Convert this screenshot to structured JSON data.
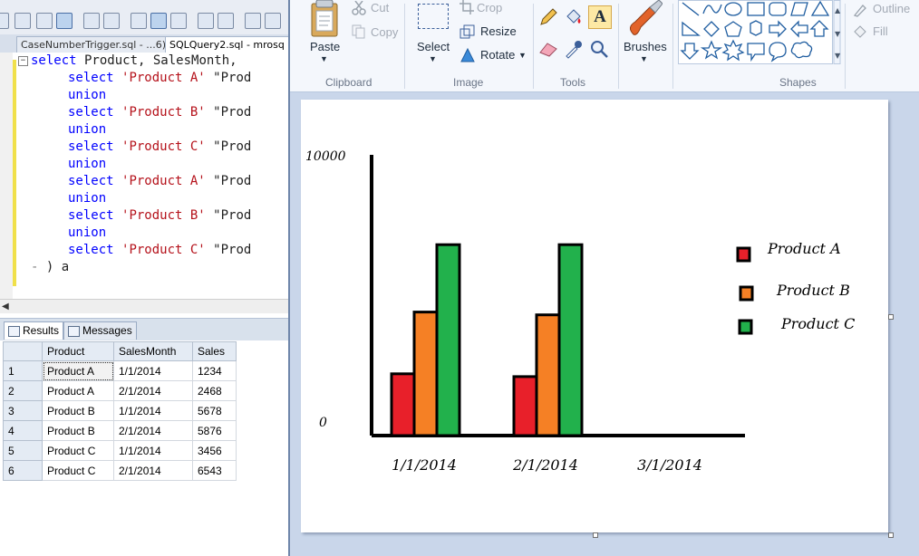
{
  "ssms": {
    "tabs": {
      "inactive": "CaseNumberTrigger.sql - ...6))",
      "active": "SQLQuery2.sql - mrosq"
    },
    "code": {
      "line1_kw": "select",
      "line1_rest": " Product, SalesMonth,",
      "select_kw": "select",
      "union_kw": "union",
      "rows": [
        {
          "literal": "'Product A'",
          "tail": " \"Prod"
        },
        {
          "literal": "'Product B'",
          "tail": " \"Prod"
        },
        {
          "literal": "'Product C'",
          "tail": " \"Prod"
        },
        {
          "literal": "'Product A'",
          "tail": " \"Prod"
        },
        {
          "literal": "'Product B'",
          "tail": " \"Prod"
        },
        {
          "literal": "'Product C'",
          "tail": " \"Prod"
        }
      ],
      "closing": ") a"
    },
    "results_tabs": [
      "Results",
      "Messages"
    ],
    "grid": {
      "columns": [
        "Product",
        "SalesMonth",
        "Sales"
      ],
      "rows": [
        {
          "n": "1",
          "product": "Product A",
          "month": "1/1/2014",
          "sales": "1234"
        },
        {
          "n": "2",
          "product": "Product A",
          "month": "2/1/2014",
          "sales": "2468"
        },
        {
          "n": "3",
          "product": "Product B",
          "month": "1/1/2014",
          "sales": "5678"
        },
        {
          "n": "4",
          "product": "Product B",
          "month": "2/1/2014",
          "sales": "5876"
        },
        {
          "n": "5",
          "product": "Product C",
          "month": "1/1/2014",
          "sales": "3456"
        },
        {
          "n": "6",
          "product": "Product C",
          "month": "2/1/2014",
          "sales": "6543"
        }
      ]
    }
  },
  "paint": {
    "clipboard": {
      "paste": "Paste",
      "cut": "Cut",
      "copy": "Copy",
      "label": "Clipboard"
    },
    "image": {
      "select": "Select",
      "crop": "Crop",
      "resize": "Resize",
      "rotate": "Rotate",
      "label": "Image"
    },
    "tools": {
      "label": "Tools"
    },
    "brushes": {
      "label": "Brushes"
    },
    "shapes": {
      "label": "Shapes",
      "outline": "Outline",
      "fill": "Fill"
    },
    "colors": {
      "red": "#e8202a",
      "orange": "#f58025",
      "green": "#22b14c",
      "black": "#000000"
    }
  },
  "chart_data": {
    "type": "bar",
    "categories": [
      "1/1/2014",
      "2/1/2014",
      "3/1/2014"
    ],
    "series": [
      {
        "name": "Product A",
        "color": "#e8202a",
        "values": [
          2200,
          2100,
          null
        ]
      },
      {
        "name": "Product B",
        "color": "#f58025",
        "values": [
          4400,
          4300,
          null
        ]
      },
      {
        "name": "Product C",
        "color": "#22b14c",
        "values": [
          6800,
          6800,
          null
        ]
      }
    ],
    "ylim": [
      0,
      10000
    ],
    "ytick_labels": [
      "10000",
      "0"
    ],
    "legend": "right",
    "grid": false
  }
}
